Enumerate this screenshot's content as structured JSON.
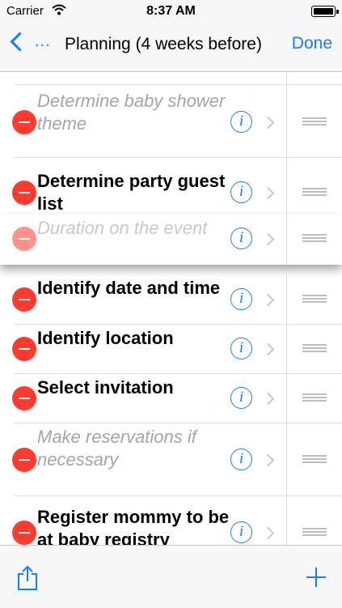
{
  "status_bar": {
    "carrier": "Carrier",
    "time": "8:37 AM"
  },
  "nav": {
    "back_label": "...",
    "title": "Planning (4 weeks before)",
    "done_label": "Done"
  },
  "items": [
    {
      "title": "",
      "style": "muted"
    },
    {
      "title": "Determine baby shower theme",
      "style": "muted"
    },
    {
      "title": "Determine party guest list",
      "style": "bold"
    },
    {
      "title": "Duration on the event",
      "style": "muted",
      "dragging": true
    },
    {
      "title": "Identify date and time",
      "style": "bold"
    },
    {
      "title": "Identify location",
      "style": "bold"
    },
    {
      "title": "Select invitation",
      "style": "bold"
    },
    {
      "title": "Make reservations if necessary",
      "style": "muted"
    },
    {
      "title": "Register mommy to be at baby registry",
      "style": "bold"
    }
  ],
  "icons": {
    "delete": "minus-circle-icon",
    "info": "info-circle-icon",
    "disclosure": "chevron-right-icon",
    "reorder": "reorder-handle-icon",
    "share": "share-icon",
    "add": "plus-icon"
  },
  "colors": {
    "accent": "#157efb",
    "delete": "#ff3b30",
    "muted_text": "#a5a5a5"
  }
}
